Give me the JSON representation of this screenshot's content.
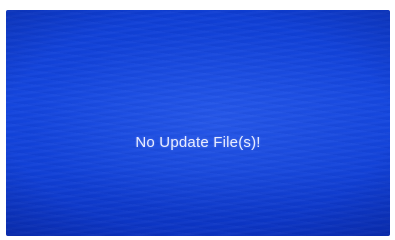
{
  "screen": {
    "message": "No Update File(s)!",
    "background_color": "#1343dc",
    "text_color": "#e8ecff"
  }
}
